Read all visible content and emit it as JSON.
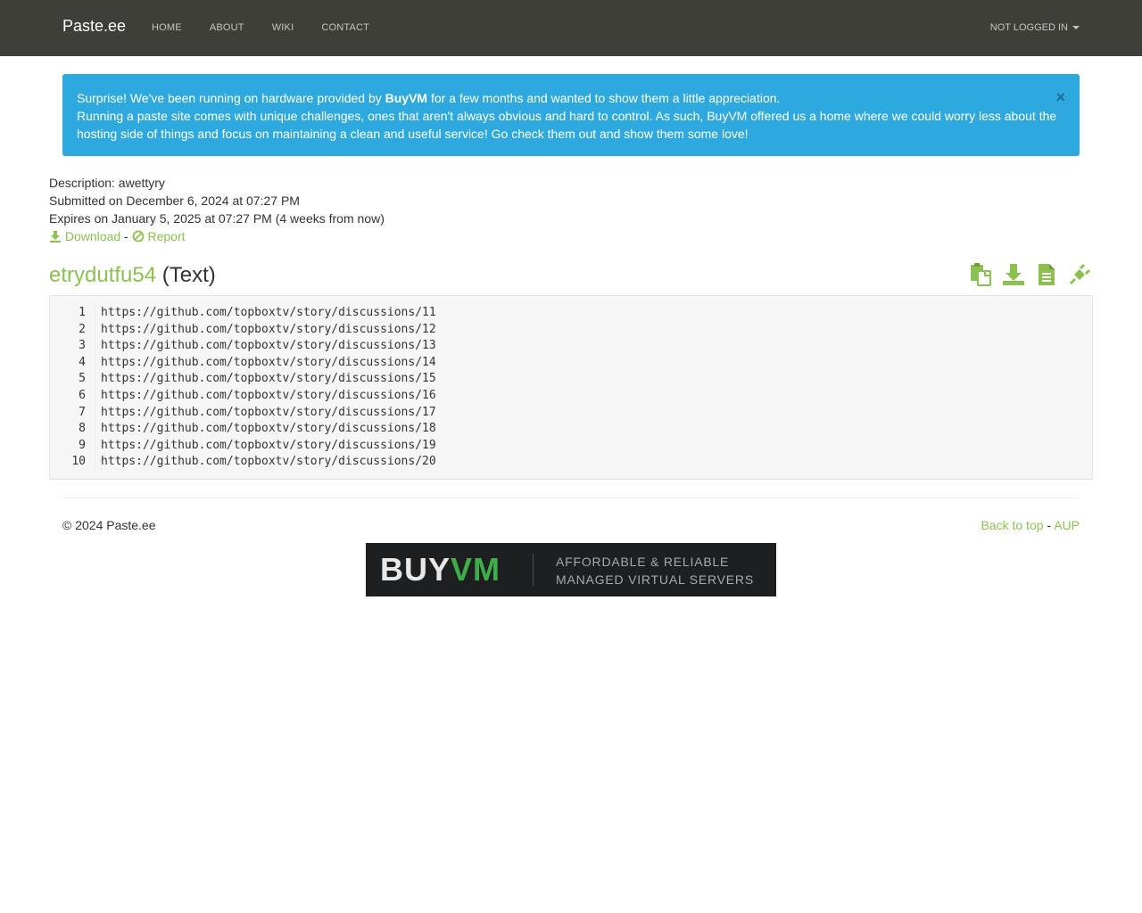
{
  "header": {
    "brand": "Paste.ee",
    "nav": [
      "HOME",
      "ABOUT",
      "WIKI",
      "CONTACT"
    ],
    "user_menu": "NOT LOGGED IN"
  },
  "alert": {
    "prefix": "Surprise! We've been running on hardware provided by ",
    "brand": "BuyVM",
    "suffix": " for a few months and wanted to show them a little appreciation.",
    "line2": "Running a paste site comes with unique challenges, ones that aren't always obvious and hard to control. As such, BuyVM offered us a home where we could worry less about the hosting side of things and focus on maintaining a clean and useful service! Go check them out and show them some love!",
    "close": "×"
  },
  "meta": {
    "description": "Description: awettyry",
    "submitted": "Submitted on December 6, 2024 at 07:27 PM",
    "expires": "Expires on January 5, 2025 at 07:27 PM (4 weeks from now)",
    "download": "Download",
    "separator": "-",
    "report": "Report"
  },
  "paste": {
    "name": "etrydutfu54",
    "type": "(Text)",
    "lines": [
      {
        "n": "1",
        "text": "https://github.com/topboxtv/story/discussions/11"
      },
      {
        "n": "2",
        "text": "https://github.com/topboxtv/story/discussions/12"
      },
      {
        "n": "3",
        "text": "https://github.com/topboxtv/story/discussions/13"
      },
      {
        "n": "4",
        "text": "https://github.com/topboxtv/story/discussions/14"
      },
      {
        "n": "5",
        "text": "https://github.com/topboxtv/story/discussions/15"
      },
      {
        "n": "6",
        "text": "https://github.com/topboxtv/story/discussions/16"
      },
      {
        "n": "7",
        "text": "https://github.com/topboxtv/story/discussions/17"
      },
      {
        "n": "8",
        "text": "https://github.com/topboxtv/story/discussions/18"
      },
      {
        "n": "9",
        "text": "https://github.com/topboxtv/story/discussions/19"
      },
      {
        "n": "10",
        "text": "https://github.com/topboxtv/story/discussions/20"
      }
    ]
  },
  "footer": {
    "copyright": "© 2024 Paste.ee",
    "back_to_top": "Back to top",
    "separator": "-",
    "aup": "AUP"
  },
  "banner": {
    "logo_a": "BUY",
    "logo_b": "VM",
    "tagline1": "AFFORDABLE & RELIABLE",
    "tagline2": "MANAGED VIRTUAL SERVERS"
  },
  "colors": {
    "navbar": "#3f3f3a",
    "accent": "#8cc152",
    "alert": "#2ea9e0"
  }
}
